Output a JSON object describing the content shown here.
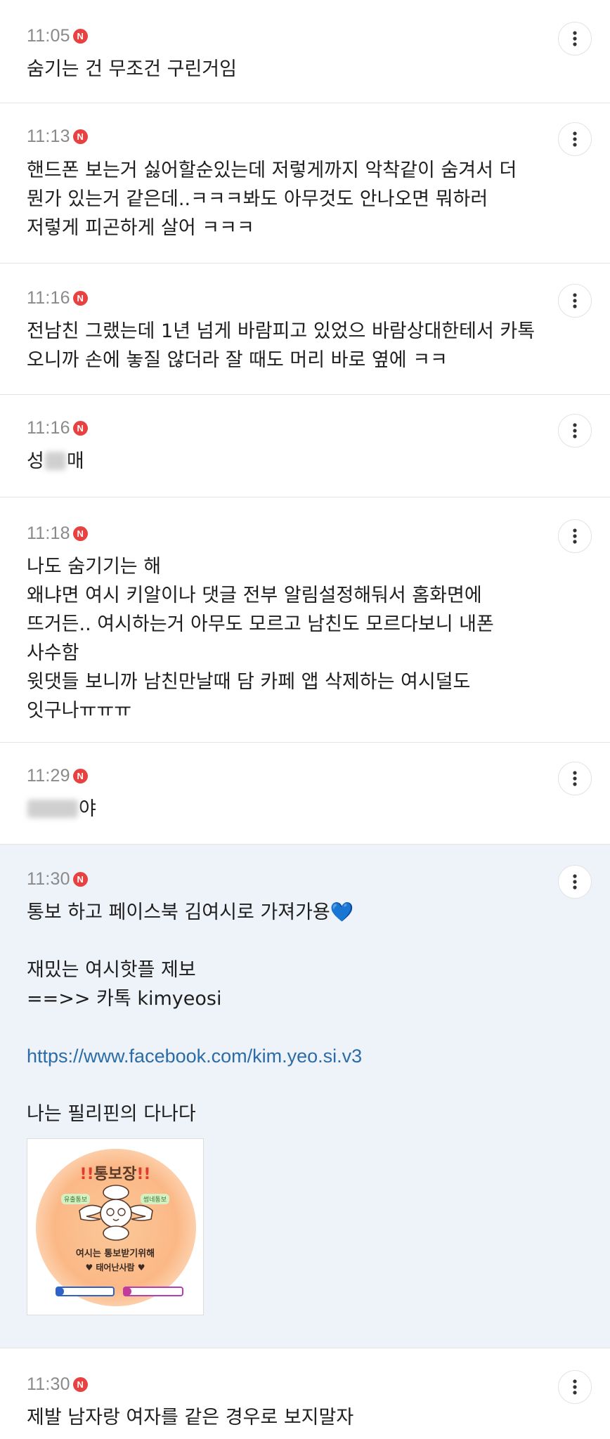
{
  "comments": [
    {
      "time": "11:05",
      "badge": "N",
      "lines": [
        "숨기는 건 무조건 구린거임"
      ]
    },
    {
      "time": "11:13",
      "badge": "N",
      "lines": [
        "핸드폰 보는거 싫어할순있는데 저렇게까지 악착같이 숨겨서 더",
        "뭔가 있는거 같은데..ㅋㅋㅋ봐도 아무것도 안나오면 뭐하러",
        "저렇게 피곤하게 살어 ㅋㅋㅋ"
      ]
    },
    {
      "time": "11:16",
      "badge": "N",
      "lines": [
        "전남친 그랬는데 1년 넘게 바람피고 있었으 바람상대한테서 카톡",
        "오니까 손에 놓질 않더라 잘 때도 머리 바로 옆에 ㅋㅋ"
      ]
    },
    {
      "time": "11:16",
      "badge": "N",
      "text_before": "성",
      "text_after": "매"
    },
    {
      "time": "11:18",
      "badge": "N",
      "lines": [
        "나도 숨기기는 해",
        "왜냐면 여시 키알이나 댓글 전부 알림설정해둬서 홈화면에",
        "뜨거든.. 여시하는거 아무도 모르고 남친도 모르다보니 내폰",
        "사수함",
        "윗댓들 보니까 남친만날때 담 카페 앱 삭제하는 여시덜도",
        "잇구나ㅠㅠㅠ"
      ]
    },
    {
      "time": "11:29",
      "badge": "N",
      "text_after": "야"
    },
    {
      "time": "11:30",
      "badge": "N",
      "line1": "통보 하고 페이스북 김여시로 가져가용",
      "heart": "💙",
      "line2": "재밌는 여시핫플 제보",
      "line3": "==>> 카톡 kimyeosi",
      "link": "https://www.facebook.com/kim.yeo.si.v3",
      "line4": "나는 필리핀의 다나다",
      "promo": {
        "title_marks": "!!",
        "title": "통보장",
        "tag_left": "유출통보",
        "tag_right": "썸네통보",
        "caption": "여시는 통보받기위해",
        "caption2": "태어난사람",
        "heart_symbol": "♥"
      }
    },
    {
      "time": "11:30",
      "badge": "N",
      "lines": [
        "제발 남자랑 여자를 같은 경우로 보지말자"
      ]
    }
  ],
  "colors": {
    "badge": "#e84141",
    "link": "#2b6ca6",
    "highlight_bg": "#eef2f9",
    "time": "#8a8a8a"
  },
  "icons": {
    "more": "more-vertical-icon",
    "new_badge": "new-n-badge-icon"
  }
}
